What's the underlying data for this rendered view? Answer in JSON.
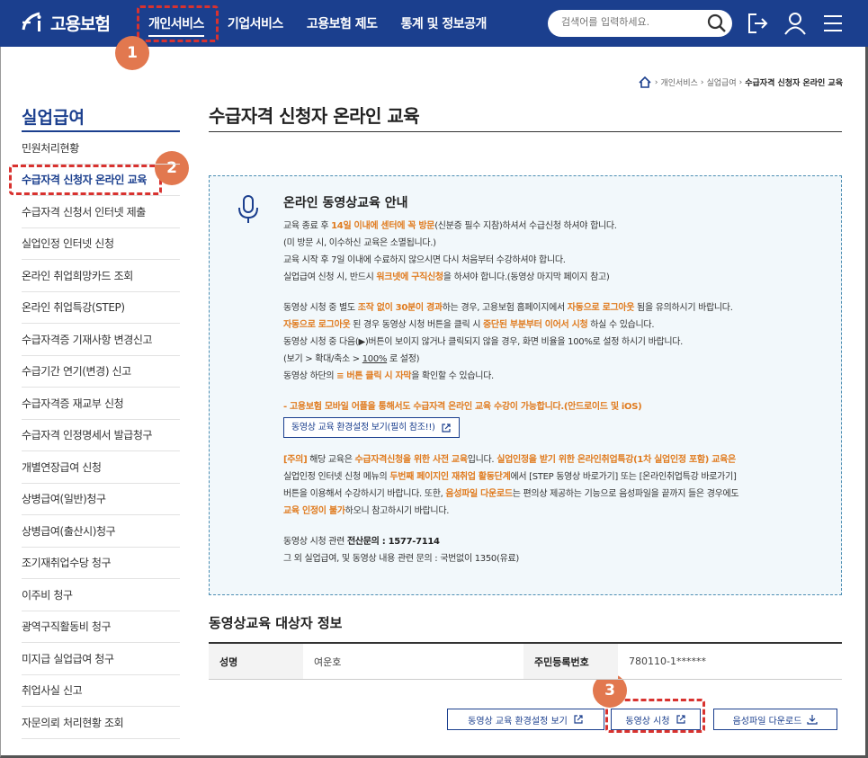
{
  "header": {
    "logo_text": "고용보험",
    "nav": [
      "개인서비스",
      "기업서비스",
      "고용보험 제도",
      "통계 및 정보공개"
    ],
    "search_placeholder": "검색어를 입력하세요."
  },
  "annotations": {
    "badge1": "1",
    "badge2": "2",
    "badge3": "3",
    "color": "#d8322f",
    "badge_color": "#e2784f"
  },
  "breadcrumb": {
    "items": [
      "개인서비스",
      "실업급여"
    ],
    "current": "수급자격 신청자 온라인 교육"
  },
  "sidebar": {
    "title": "실업급여",
    "items": [
      "민원처리현황",
      "수급자격 신청자 온라인 교육",
      "수급자격 신청서 인터넷 제출",
      "실업인정 인터넷 신청",
      "온라인 취업희망카드 조회",
      "온라인 취업특강(STEP)",
      "수급자격증 기재사항 변경신고",
      "수급기간 연기(변경) 신고",
      "수급자격증 재교부 신청",
      "수급자격 인정명세서 발급청구",
      "개별연장급여 신청",
      "상병급여(일반)청구",
      "상병급여(출산시)청구",
      "조기재취업수당 청구",
      "이주비 청구",
      "광역구직활동비 청구",
      "미지급 실업급여 청구",
      "취업사실 신고",
      "자문의뢰 처리현황 조회"
    ],
    "active_index": 1
  },
  "main": {
    "title": "수급자격 신청자 온라인 교육",
    "notice": {
      "title": "온라인 동영상교육 안내",
      "p1": {
        "l1a": "교육 종료 후 ",
        "l1b": "14일 이내에 센터에 꼭 방문",
        "l1c": "(신분증 필수 지참)하셔서 수급신청 하셔야 합니다.",
        "l2": "(미 방문 시, 이수하신 교육은 소멸됩니다.)",
        "l3": "교육 시작 후 7일 이내에 수료하지 않으시면 다시 처음부터 수강하셔야 합니다.",
        "l4a": "실업급여 신청 시, 반드시 ",
        "l4b": "워크넷에 구직신청",
        "l4c": "을 하셔야 합니다.(동영상 마지막 페이지 참고)"
      },
      "p2": {
        "l1a": "동영상 시청 중 별도 ",
        "l1b": "조작 없이 30분이 경과",
        "l1c": "하는 경우, 고용보험 홈페이지에서 ",
        "l1d": "자동으로 로그아웃",
        "l1e": " 됨을 유의하시기 바랍니다.",
        "l2a": "자동으로 로그아웃",
        "l2b": " 된 경우 동영상 시청 버튼을 클릭 시 ",
        "l2c": "중단된 부분부터 이어서 시청",
        "l2d": " 하실 수 있습니다.",
        "l3": "동영상 시청 중 다음(▶)버튼이 보이지 않거나 클릭되지 않을 경우, 화면 비율을 100%로 설정 하시기 바랍니다.",
        "l4a": "(보기 > 확대/축소 > ",
        "l4b": "100%",
        "l4c": " 로 설정)",
        "l5a": "동영상 하단의 ",
        "l5b": "≡ 버튼 클릭 시 자막",
        "l5c": "을 확인할 수 있습니다."
      },
      "mobile": "- 고용보험 모바일 어플을 통해서도 수급자격 온라인 교육 수강이 가능합니다.(안드로이드 및 iOS)",
      "env_button": "동영상 교육 환경설정 보기(필히 참조!!)",
      "caution": {
        "l1a": "[주의]",
        "l1b": " 해당 교육은 ",
        "l1c": "수급자격신청을 위한 사전 교육",
        "l1d": "입니다. ",
        "l1e": "실업인정을 받기 위한 온라인취업특강(1차 실업인정 포함) 교육은",
        "l2a": "실업인정 인터넷 신청 메뉴의 ",
        "l2b": "두번째 페이지인 재취업 활동단계",
        "l2c": "에서 [STEP 동영상 바로가기] 또는 [온라인취업특강 바로가기]",
        "l3a": "버튼을 이용해서 수강하시기 바랍니다. 또한, ",
        "l3b": "음성파일 다운로드",
        "l3c": "는 편의상 제공하는 기능으로 음성파일을 끝까지 들은 경우에도",
        "l4a": "교육 인정이 불가",
        "l4b": "하오니 참고하시기 바랍니다."
      },
      "contact1a": "동영상 시청 관련 ",
      "contact1b": "전산문의 : 1577-7114",
      "contact2": "그 외 실업급여, 및 동영상 내용 관련 문의 : 국번없이 1350(유료)"
    },
    "info_section": {
      "title": "동영상교육 대상자 정보",
      "name_label": "성명",
      "name_value": "여운호",
      "rrn_label": "주민등록번호",
      "rrn_value": "780110-1******"
    },
    "buttons": {
      "env": "동영상 교육 환경설정 보기",
      "watch": "동영상 시청",
      "audio": "음성파일 다운로드"
    }
  }
}
